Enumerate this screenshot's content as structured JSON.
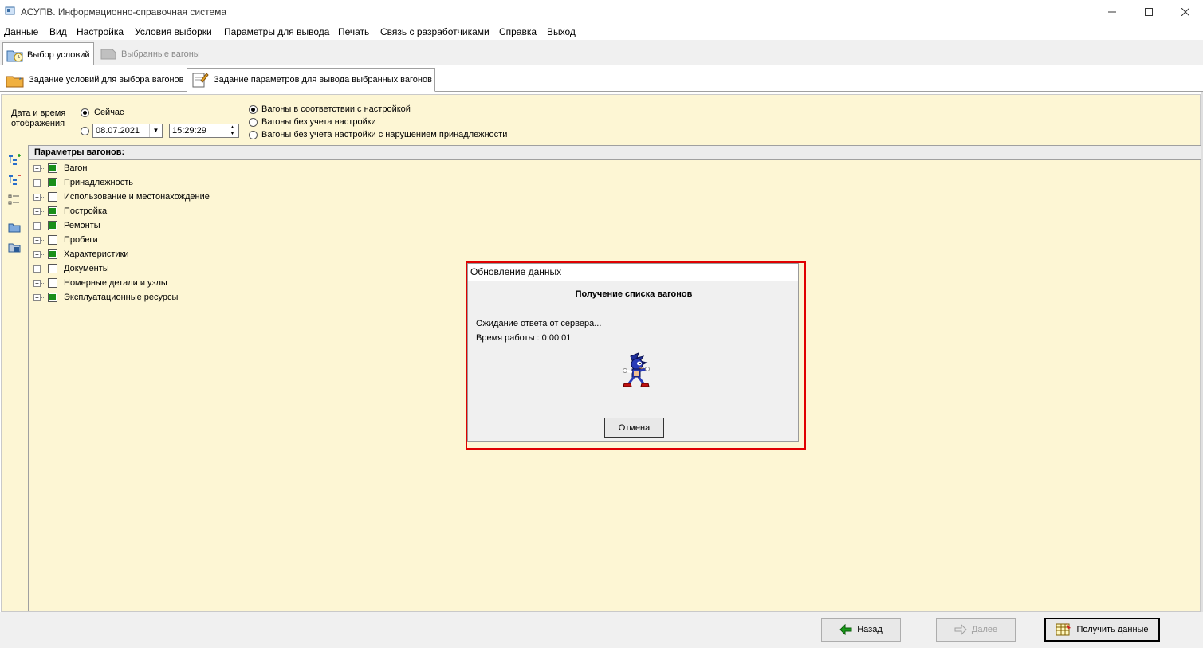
{
  "window": {
    "title": "АСУПВ. Информационно-справочная система",
    "minimize_icon": "minimize-icon",
    "maximize_icon": "maximize-icon",
    "close_icon": "close-icon"
  },
  "menu": [
    "Данные",
    "Вид",
    "Настройка",
    "Условия выборки",
    "Параметры для вывода",
    "Печать",
    "Связь с разработчиками",
    "Справка",
    "Выход"
  ],
  "top_tabs": [
    {
      "label": "Выбор условий",
      "icon": "folder-clock-icon",
      "active": true
    },
    {
      "label": "Выбранные вагоны",
      "icon": "wagon-icon",
      "active": false
    }
  ],
  "sub_tabs": [
    {
      "label": "Задание условий для выбора вагонов",
      "icon": "folder-edit-icon",
      "active": false
    },
    {
      "label": "Задание параметров для вывода выбранных вагонов",
      "icon": "document-edit-icon",
      "active": true
    }
  ],
  "conditions": {
    "datetime_label": "Дата и время отображения",
    "now_label": "Сейчас",
    "date_value": "08.07.2021",
    "time_value": "15:29:29",
    "mode_options": [
      {
        "label": "Вагоны в соответствии с настройкой",
        "selected": true
      },
      {
        "label": "Вагоны без учета настройки",
        "selected": false
      },
      {
        "label": "Вагоны без учета настройки с нарушением принадлежности",
        "selected": false
      }
    ]
  },
  "tree": {
    "header": "Параметры вагонов:",
    "items": [
      {
        "label": "Вагон",
        "checked": true
      },
      {
        "label": "Принадлежность",
        "checked": true
      },
      {
        "label": "Использование и местонахождение",
        "checked": false
      },
      {
        "label": "Постройка",
        "checked": true
      },
      {
        "label": "Ремонты",
        "checked": true
      },
      {
        "label": "Пробеги",
        "checked": false
      },
      {
        "label": "Характеристики",
        "checked": true
      },
      {
        "label": "Документы",
        "checked": false
      },
      {
        "label": "Номерные детали и узлы",
        "checked": false
      },
      {
        "label": "Эксплуатационные ресурсы",
        "checked": true
      }
    ]
  },
  "buttons": {
    "back": "Назад",
    "next": "Далее",
    "get_data": "Получить данные"
  },
  "dialog": {
    "title": "Обновление данных",
    "heading": "Получение списка вагонов",
    "status": "Ожидание ответа от сервера...",
    "time": "Время работы : 0:00:01",
    "cancel": "Отмена",
    "animation_icon": "running-character-icon"
  },
  "colors": {
    "panel_bg": "#fdf6d4",
    "checkbox_fill": "#1a8f1a",
    "highlight": "#e00000"
  }
}
